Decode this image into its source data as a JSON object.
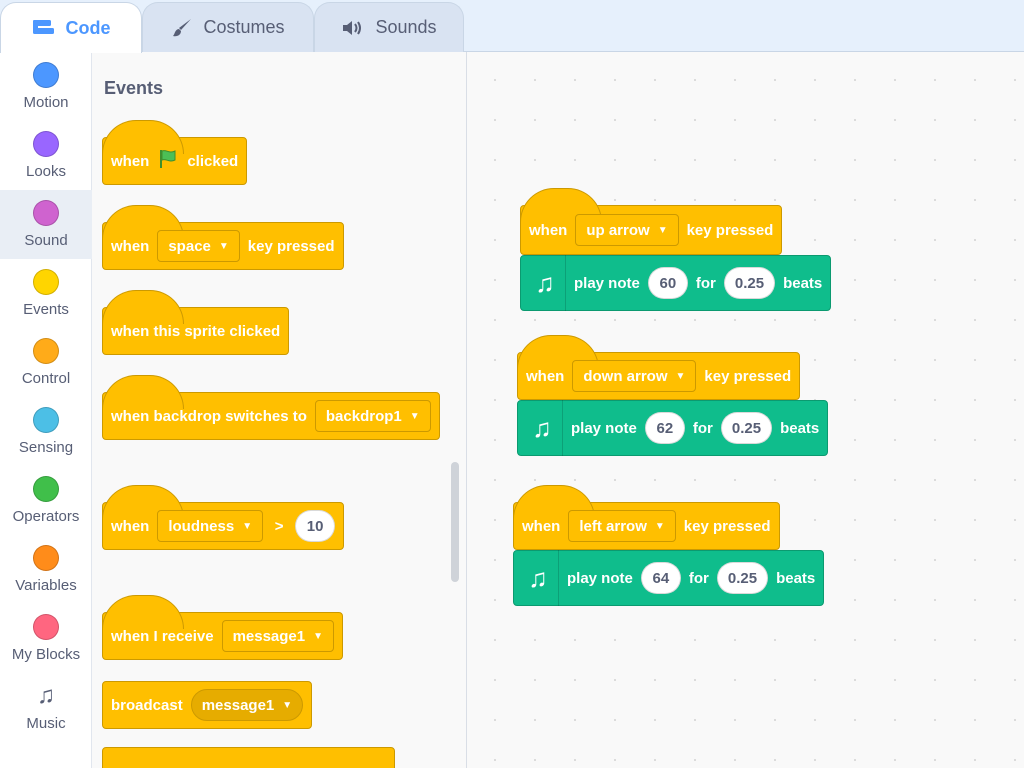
{
  "tabs": {
    "code": "Code",
    "costumes": "Costumes",
    "sounds": "Sounds"
  },
  "categories": [
    {
      "label": "Motion",
      "color": "#4c97ff"
    },
    {
      "label": "Looks",
      "color": "#9966ff"
    },
    {
      "label": "Sound",
      "color": "#cf63cf"
    },
    {
      "label": "Events",
      "color": "#ffd500"
    },
    {
      "label": "Control",
      "color": "#ffab19"
    },
    {
      "label": "Sensing",
      "color": "#4cbfe6"
    },
    {
      "label": "Operators",
      "color": "#40bf4a"
    },
    {
      "label": "Variables",
      "color": "#ff8c1a"
    },
    {
      "label": "My Blocks",
      "color": "#ff6680"
    },
    {
      "label": "Music",
      "icon": "music-notes-icon"
    }
  ],
  "selected_category": "Sound",
  "flyout": {
    "title": "Events",
    "blocks": {
      "flag": {
        "when": "when",
        "clicked": "clicked"
      },
      "key": {
        "when": "when",
        "key": "space",
        "suffix": "key pressed"
      },
      "sprite": {
        "text": "when this sprite clicked"
      },
      "backdrop": {
        "text": "when backdrop switches to",
        "value": "backdrop1"
      },
      "loudness": {
        "when": "when",
        "param": "loudness",
        "op": ">",
        "value": "10"
      },
      "receive": {
        "text": "when I receive",
        "value": "message1"
      },
      "broadcast": {
        "text": "broadcast",
        "value": "message1"
      }
    }
  },
  "scripts": [
    {
      "when": "when",
      "key": "up arrow",
      "suffix": "key pressed",
      "play": "play note",
      "note": "60",
      "for": "for",
      "beats_value": "0.25",
      "beats": "beats"
    },
    {
      "when": "when",
      "key": "down arrow",
      "suffix": "key pressed",
      "play": "play note",
      "note": "62",
      "for": "for",
      "beats_value": "0.25",
      "beats": "beats"
    },
    {
      "when": "when",
      "key": "left arrow",
      "suffix": "key pressed",
      "play": "play note",
      "note": "64",
      "for": "for",
      "beats_value": "0.25",
      "beats": "beats"
    }
  ],
  "colors": {
    "events": "#ffbf00",
    "music": "#0fbd8c",
    "accent": "#4c97ff"
  }
}
